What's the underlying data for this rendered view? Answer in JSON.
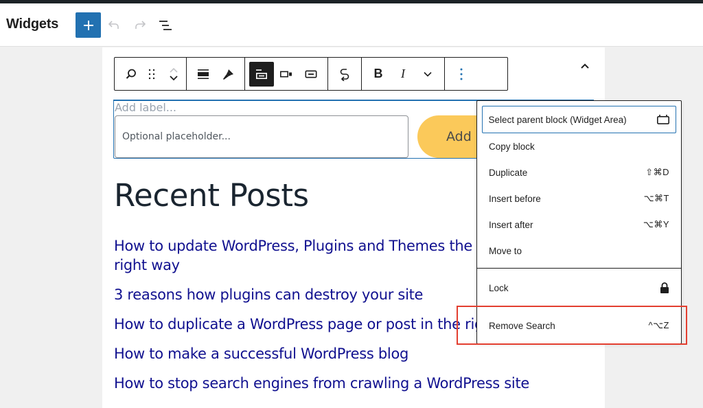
{
  "header": {
    "title": "Widgets",
    "add_block_icon": "plus-icon",
    "undo_icon": "undo-icon",
    "redo_icon": "redo-icon",
    "list_view_icon": "list-view-icon"
  },
  "toolbar": {
    "groups": [
      [
        "search-icon",
        "drag-handle-icon",
        "move-up-icon",
        "move-down-icon"
      ],
      [
        "justify-icon",
        "style-brush-icon"
      ],
      [
        "label-position-icon",
        "button-outside-icon",
        "button-inside-icon"
      ],
      [
        "transform-icon"
      ],
      [
        "bold-icon",
        "italic-icon",
        "more-rich-text-chevron-icon"
      ],
      [
        "options-kebab-icon"
      ]
    ],
    "active": "label-position-icon",
    "collapse_icon": "chevron-up-icon"
  },
  "search_block": {
    "label_placeholder": "Add label...",
    "input_placeholder": "Optional placeholder...",
    "button_label": "Add"
  },
  "recent_posts": {
    "title": "Recent Posts",
    "items": [
      "How to update WordPress, Plugins and Themes the right way",
      "3 reasons how plugins can destroy your site",
      "How to duplicate a WordPress page or post in the right way",
      "How to make a successful WordPress blog",
      "How to stop search engines from crawling a WordPress site"
    ]
  },
  "options_menu": {
    "items": [
      {
        "label": "Select parent block (Widget Area)",
        "shortcut": "",
        "icon": "widget-area-icon"
      },
      {
        "label": "Copy block",
        "shortcut": ""
      },
      {
        "label": "Duplicate",
        "shortcut": "⇧⌘D"
      },
      {
        "label": "Insert before",
        "shortcut": "⌥⌘T"
      },
      {
        "label": "Insert after",
        "shortcut": "⌥⌘Y"
      },
      {
        "label": "Move to",
        "shortcut": ""
      }
    ],
    "lock": {
      "label": "Lock",
      "icon": "lock-icon"
    },
    "remove": {
      "label": "Remove Search",
      "shortcut": "^⌥Z"
    }
  },
  "colors": {
    "accent": "#2271b1",
    "highlight": "#e33e2f",
    "submit_button": "#fbc95a",
    "link": "#10108f"
  }
}
